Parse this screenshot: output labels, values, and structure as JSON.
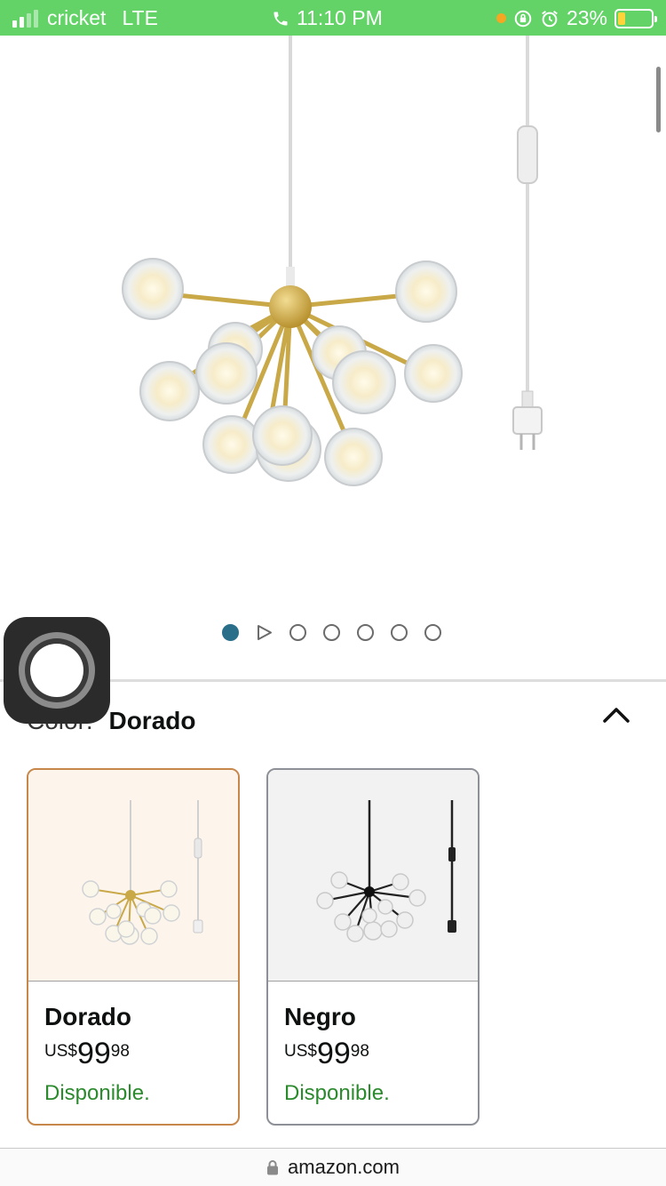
{
  "status_bar": {
    "carrier": "cricket",
    "network": "LTE",
    "time": "11:10 PM",
    "battery_percent": "23%",
    "battery_level": 0.23
  },
  "gallery": {
    "image_count": 7,
    "active_index": 0,
    "accent_color": "#2a6f8a"
  },
  "variation": {
    "label": "Color:",
    "selected_value": "Dorado",
    "options": [
      {
        "name": "Dorado",
        "currency": "US$",
        "price_whole": "99",
        "price_fraction": "98",
        "availability": "Disponible.",
        "selected": true
      },
      {
        "name": "Negro",
        "currency": "US$",
        "price_whole": "99",
        "price_fraction": "98",
        "availability": "Disponible.",
        "selected": false
      }
    ]
  },
  "browser": {
    "domain": "amazon.com"
  },
  "colors": {
    "status_bar_bg": "#63d368",
    "selected_border": "#c8874a",
    "availability_green": "#2c8a2e"
  }
}
